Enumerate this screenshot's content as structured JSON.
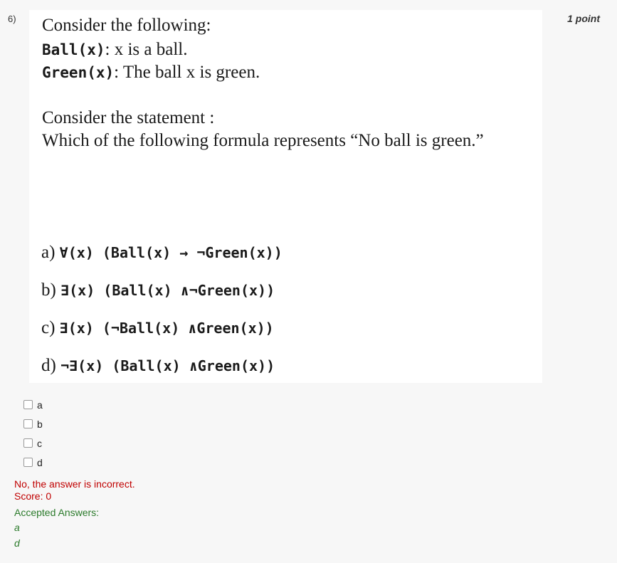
{
  "question": {
    "number": "6)",
    "points": "1 point",
    "text": {
      "line1": "Consider the following:",
      "line2_code": "Ball(x)",
      "line2_rest": ": x is a ball.",
      "line2_x": "x",
      "line3_code": "Green(x)",
      "line3_rest": ": The ball x is green.",
      "line4": "Consider the statement :",
      "line5": "Which of the following formula represents “No ball is green.”"
    },
    "image_options": [
      {
        "label": "a)",
        "formula": "∀(x) (Ball(x) → ¬Green(x))"
      },
      {
        "label": "b)",
        "formula": "∃(x) (Ball(x) ∧¬Green(x))"
      },
      {
        "label": "c)",
        "formula": "∃(x) (¬Ball(x) ∧Green(x))"
      },
      {
        "label": "d)",
        "formula": "¬∃(x) (Ball(x) ∧Green(x))"
      }
    ]
  },
  "choices": [
    {
      "label": "a",
      "checked": false
    },
    {
      "label": "b",
      "checked": false
    },
    {
      "label": "c",
      "checked": false
    },
    {
      "label": "d",
      "checked": false
    }
  ],
  "feedback": {
    "result": "No, the answer is incorrect.",
    "score": "Score: 0",
    "accepted_label": "Accepted Answers:",
    "accepted": [
      "a",
      "d"
    ]
  },
  "colors": {
    "incorrect": "#c00000",
    "accepted": "#2a7a2a",
    "background": "#f7f7f7"
  }
}
